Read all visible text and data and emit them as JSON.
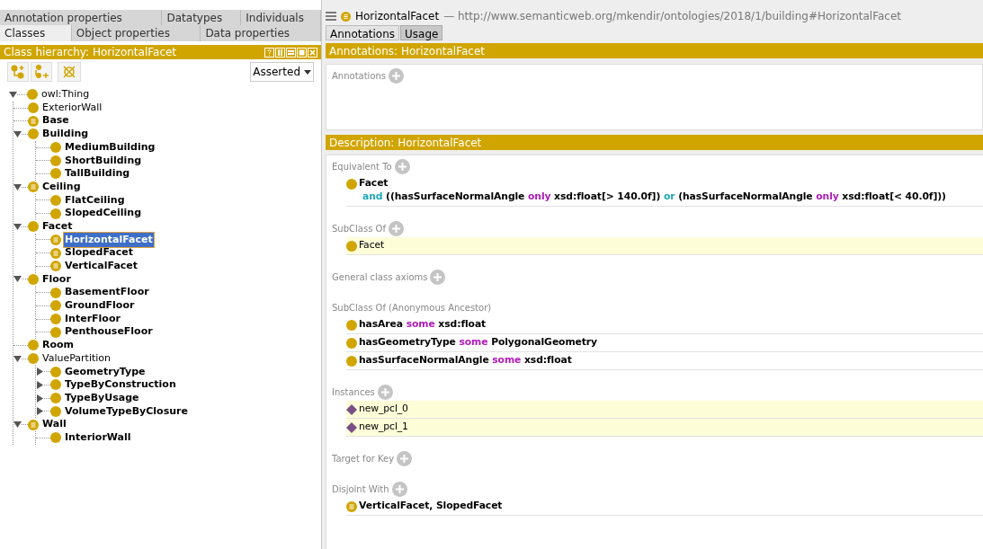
{
  "left_tabs_row1": [
    {
      "label": "Annotation properties",
      "selected": false
    },
    {
      "label": "Datatypes",
      "selected": false
    },
    {
      "label": "Individuals",
      "selected": false
    }
  ],
  "left_tabs_row2": [
    {
      "label": "Classes",
      "selected": true
    },
    {
      "label": "Object properties",
      "selected": false
    },
    {
      "label": "Data properties",
      "selected": false
    }
  ],
  "hierarchy": {
    "title": "Class hierarchy: HorizontalFacet",
    "mode": "Asserted",
    "tree": [
      {
        "label": "owl:Thing",
        "bold": false,
        "defined": false,
        "selected": false,
        "expanded": true,
        "children": [
          {
            "label": "ExteriorWall",
            "bold": false,
            "defined": false,
            "selected": false
          },
          {
            "label": "Base",
            "bold": true,
            "defined": true,
            "selected": false
          },
          {
            "label": "Building",
            "bold": true,
            "defined": false,
            "selected": false,
            "expanded": true,
            "children": [
              {
                "label": "MediumBuilding",
                "bold": true,
                "defined": false,
                "selected": false
              },
              {
                "label": "ShortBuilding",
                "bold": true,
                "defined": false,
                "selected": false
              },
              {
                "label": "TallBuilding",
                "bold": true,
                "defined": false,
                "selected": false
              }
            ]
          },
          {
            "label": "Ceiling",
            "bold": true,
            "defined": true,
            "selected": false,
            "expanded": true,
            "children": [
              {
                "label": "FlatCeiling",
                "bold": true,
                "defined": false,
                "selected": false
              },
              {
                "label": "SlopedCeiling",
                "bold": true,
                "defined": false,
                "selected": false
              }
            ]
          },
          {
            "label": "Facet",
            "bold": true,
            "defined": false,
            "selected": false,
            "expanded": true,
            "children": [
              {
                "label": "HorizontalFacet",
                "bold": true,
                "defined": true,
                "selected": true
              },
              {
                "label": "SlopedFacet",
                "bold": true,
                "defined": true,
                "selected": false
              },
              {
                "label": "VerticalFacet",
                "bold": true,
                "defined": true,
                "selected": false
              }
            ]
          },
          {
            "label": "Floor",
            "bold": true,
            "defined": false,
            "selected": false,
            "expanded": true,
            "children": [
              {
                "label": "BasementFloor",
                "bold": true,
                "defined": false,
                "selected": false
              },
              {
                "label": "GroundFloor",
                "bold": true,
                "defined": false,
                "selected": false
              },
              {
                "label": "InterFloor",
                "bold": true,
                "defined": false,
                "selected": false
              },
              {
                "label": "PenthouseFloor",
                "bold": true,
                "defined": false,
                "selected": false
              }
            ]
          },
          {
            "label": "Room",
            "bold": true,
            "defined": false,
            "selected": false
          },
          {
            "label": "ValuePartition",
            "bold": false,
            "defined": false,
            "selected": false,
            "expanded": true,
            "children": [
              {
                "label": "GeometryType",
                "bold": true,
                "defined": false,
                "selected": false,
                "expanded": false
              },
              {
                "label": "TypeByConstruction",
                "bold": true,
                "defined": false,
                "selected": false,
                "expanded": false
              },
              {
                "label": "TypeByUsage",
                "bold": true,
                "defined": false,
                "selected": false,
                "expanded": false
              },
              {
                "label": "VolumeTypeByClosure",
                "bold": true,
                "defined": false,
                "selected": false,
                "expanded": false
              }
            ]
          },
          {
            "label": "Wall",
            "bold": true,
            "defined": true,
            "selected": false,
            "expanded": true,
            "children": [
              {
                "label": "InteriorWall",
                "bold": true,
                "defined": false,
                "selected": false
              }
            ]
          }
        ]
      }
    ]
  },
  "entity": {
    "name": "HorizontalFacet",
    "iri": "— http://www.semanticweb.org/mkendir/ontologies/2018/1/building#HorizontalFacet"
  },
  "right_tabs": [
    {
      "label": "Annotations",
      "selected": true
    },
    {
      "label": "Usage",
      "selected": false
    }
  ],
  "annotations": {
    "title": "Annotations: HorizontalFacet",
    "section": "Annotations"
  },
  "description": {
    "title": "Description: HorizontalFacet",
    "sections": [
      {
        "title": "Equivalent To",
        "addable": true,
        "items": [
          {
            "kind": "class",
            "highlighted": false,
            "lines": [
              [
                {
                  "text": "Facet",
                  "kind": "entity"
                }
              ],
              [
                {
                  "text": "and",
                  "kind": "connective"
                },
                {
                  "text": "((hasSurfaceNormalAngle",
                  "kind": "entity"
                },
                {
                  "text": "only",
                  "kind": "quantifier"
                },
                {
                  "text": "xsd:float[> 140.0f])",
                  "kind": "entity"
                },
                {
                  "text": "or",
                  "kind": "connective"
                },
                {
                  "text": "(hasSurfaceNormalAngle",
                  "kind": "entity"
                },
                {
                  "text": "only",
                  "kind": "quantifier"
                },
                {
                  "text": "xsd:float[< 40.0f]))",
                  "kind": "entity"
                }
              ]
            ]
          }
        ]
      },
      {
        "title": "SubClass Of",
        "addable": true,
        "items": [
          {
            "kind": "class",
            "highlighted": true,
            "lines": [
              [
                {
                  "text": "Facet",
                  "kind": "plain"
                }
              ]
            ]
          }
        ]
      },
      {
        "title": "General class axioms",
        "addable": true
      },
      {
        "title": "SubClass Of (Anonymous Ancestor)",
        "addable": false,
        "items": [
          {
            "kind": "class",
            "highlighted": false,
            "lines": [
              [
                {
                  "text": "hasArea",
                  "kind": "entity"
                },
                {
                  "text": "some",
                  "kind": "quantifier"
                },
                {
                  "text": "xsd:float",
                  "kind": "entity"
                }
              ]
            ]
          },
          {
            "kind": "class",
            "highlighted": false,
            "lines": [
              [
                {
                  "text": "hasGeometryType",
                  "kind": "entity"
                },
                {
                  "text": "some",
                  "kind": "quantifier"
                },
                {
                  "text": "PolygonalGeometry",
                  "kind": "entity"
                }
              ]
            ]
          },
          {
            "kind": "class",
            "highlighted": false,
            "lines": [
              [
                {
                  "text": "hasSurfaceNormalAngle",
                  "kind": "entity"
                },
                {
                  "text": "some",
                  "kind": "quantifier"
                },
                {
                  "text": "xsd:float",
                  "kind": "entity"
                }
              ]
            ]
          }
        ]
      },
      {
        "title": "Instances",
        "addable": true,
        "items": [
          {
            "kind": "individual",
            "highlighted": true,
            "lines": [
              [
                {
                  "text": "new_pcl_0",
                  "kind": "plain"
                }
              ]
            ]
          },
          {
            "kind": "individual",
            "highlighted": true,
            "lines": [
              [
                {
                  "text": "new_pcl_1",
                  "kind": "plain"
                }
              ]
            ]
          }
        ]
      },
      {
        "title": "Target for Key",
        "addable": true
      },
      {
        "title": "Disjoint With",
        "addable": true,
        "items": [
          {
            "kind": "defined",
            "highlighted": false,
            "lines": [
              [
                {
                  "text": "VerticalFacet, SlopedFacet",
                  "kind": "entity"
                }
              ]
            ]
          }
        ]
      }
    ]
  }
}
